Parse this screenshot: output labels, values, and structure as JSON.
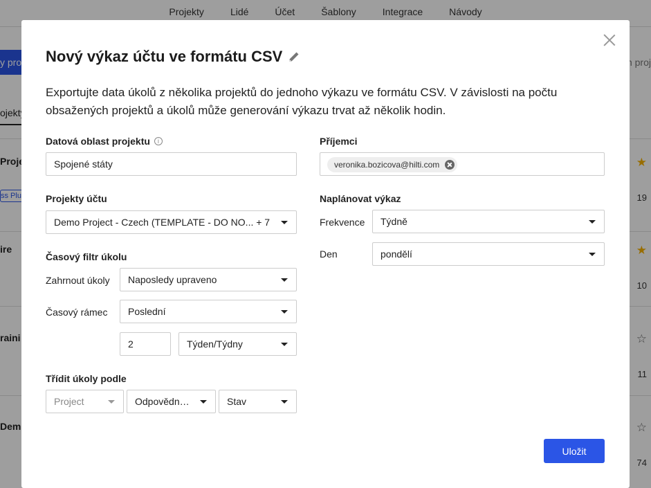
{
  "background": {
    "nav": [
      "Projekty",
      "Lidé",
      "Účet",
      "Šablony",
      "Integrace",
      "Návody"
    ],
    "blue_button": "y pro",
    "search_text": "ch proj",
    "tab": "ojekty",
    "rows": [
      {
        "text": "Proje",
        "number": "19",
        "starred": true
      },
      {
        "text": "ire",
        "number": "10",
        "starred": true
      },
      {
        "text": "raini",
        "number": "11",
        "starred": false
      },
      {
        "text": "Dem",
        "number": "74",
        "starred": false
      }
    ],
    "pill": "ss Plu"
  },
  "modal": {
    "title": "Nový výkaz účtu ve formátu CSV",
    "description": "Exportujte data úkolů z několika projektů do jednoho výkazu ve formátu CSV. V závislosti na počtu obsažených projektů a úkolů může generování výkazu trvat až několik hodin.",
    "data_region": {
      "label": "Datová oblast projektu",
      "value": "Spojené státy"
    },
    "recipients": {
      "label": "Příjemci",
      "chips": [
        "veronika.bozicova@hilti.com"
      ]
    },
    "account_projects": {
      "label": "Projekty účtu",
      "value": "Demo Project - Czech (TEMPLATE - DO NO... + 7"
    },
    "schedule": {
      "label": "Naplánovat výkaz",
      "frequency_label": "Frekvence",
      "frequency_value": "Týdně",
      "day_label": "Den",
      "day_value": "pondělí"
    },
    "time_filter": {
      "label": "Časový filtr úkolu",
      "include_label": "Zahrnout úkoly",
      "include_value": "Naposledy upraveno",
      "timeframe_label": "Časový rámec",
      "timeframe_value": "Poslední",
      "count_value": "2",
      "unit_value": "Týden/Týdny"
    },
    "sort": {
      "label": "Třídit úkoly podle",
      "first": "Project",
      "second": "Odpovědná ...",
      "third": "Stav"
    },
    "save_label": "Uložit"
  },
  "colors": {
    "accent": "#2b55e6",
    "star_filled": "#f5b100"
  }
}
